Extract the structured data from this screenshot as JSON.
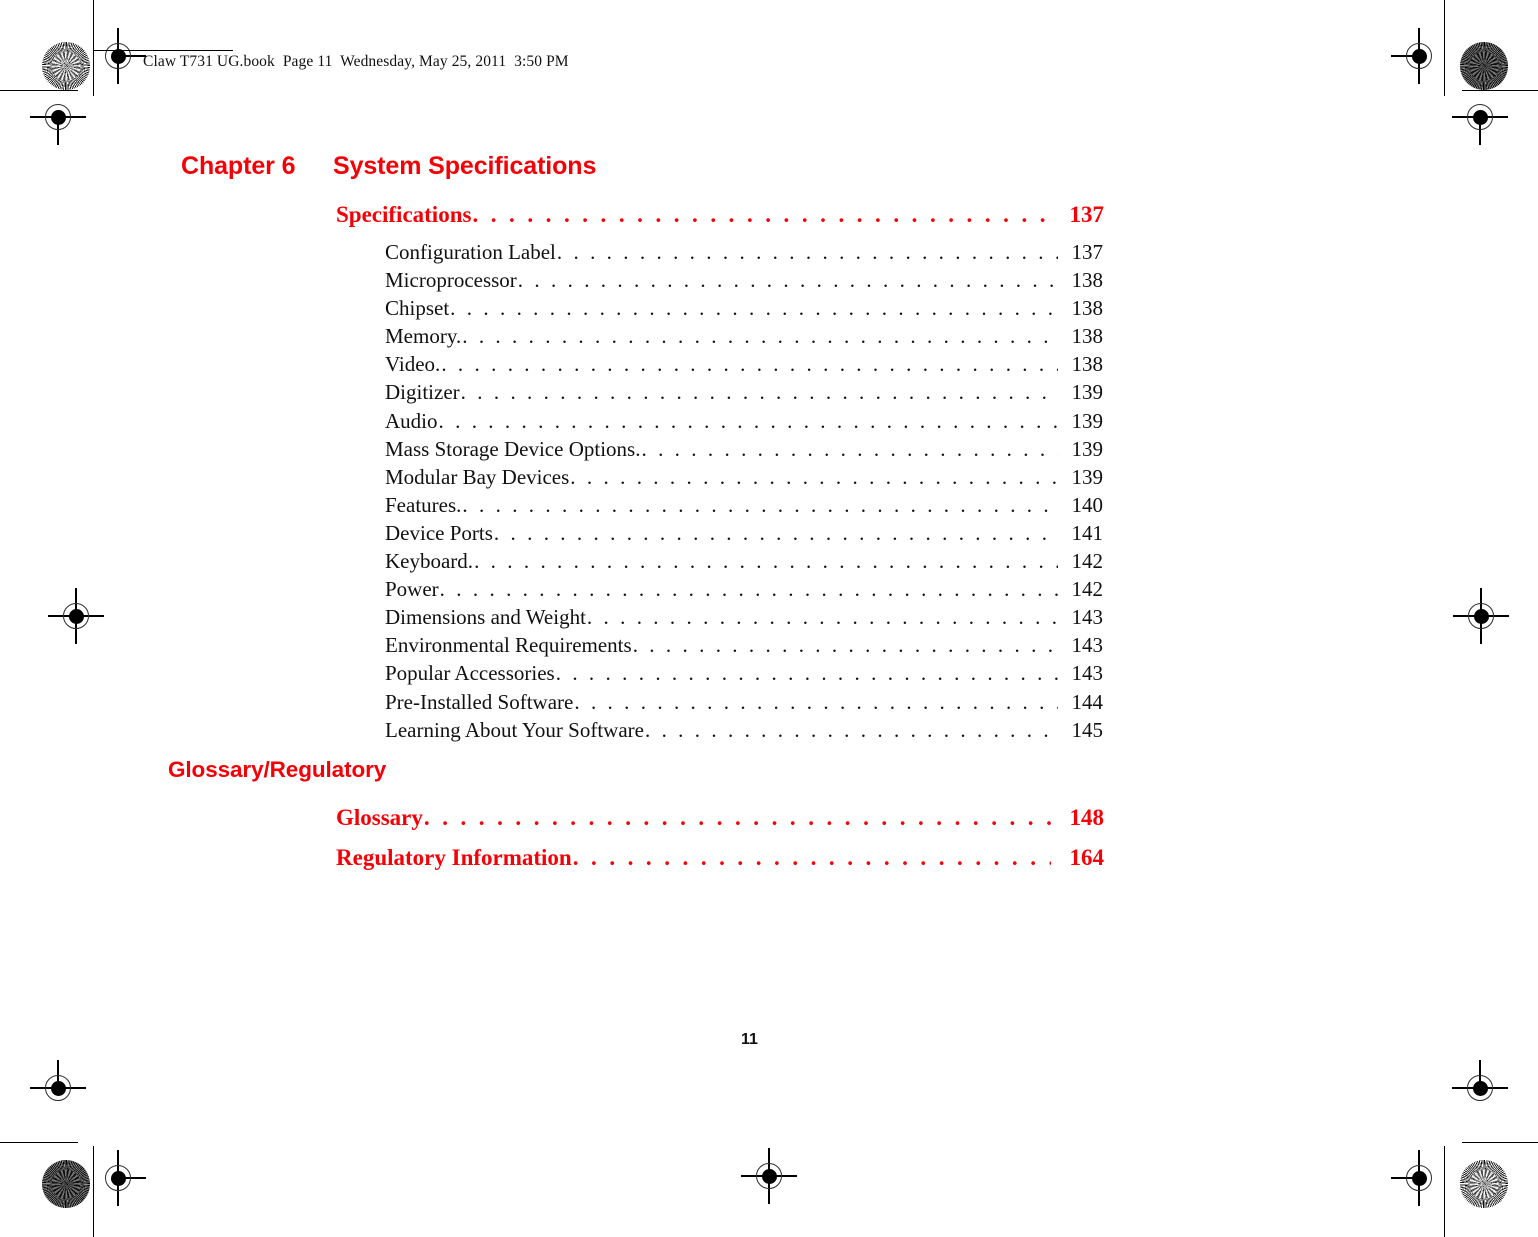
{
  "header": {
    "text": "Claw T731 UG.book  Page 11  Wednesday, May 25, 2011  3:50 PM"
  },
  "folio": {
    "page_number": "11"
  },
  "colors": {
    "accent_red": "#f60007",
    "body_black": "#111111",
    "page_background": "#ffffff"
  },
  "chapter": {
    "number_label": "Chapter 6",
    "title": "System Specifications"
  },
  "toc": {
    "sections": [
      {
        "id": "specifications",
        "heading": {
          "label": "Specifications",
          "page": "137"
        },
        "entries": [
          {
            "label": "Configuration Label",
            "page": "137"
          },
          {
            "label": "Microprocessor",
            "page": "138"
          },
          {
            "label": "Chipset",
            "page": "138"
          },
          {
            "label": "Memory.",
            "page": "138"
          },
          {
            "label": "Video.",
            "page": "138"
          },
          {
            "label": "Digitizer",
            "page": "139"
          },
          {
            "label": "Audio",
            "page": "139"
          },
          {
            "label": "Mass Storage Device Options.",
            "page": "139"
          },
          {
            "label": "Modular Bay Devices",
            "page": "139"
          },
          {
            "label": "Features.",
            "page": "140"
          },
          {
            "label": "Device Ports",
            "page": "141"
          },
          {
            "label": "Keyboard.",
            "page": "142"
          },
          {
            "label": "Power",
            "page": "142"
          },
          {
            "label": "Dimensions and Weight",
            "page": "143"
          },
          {
            "label": "Environmental Requirements",
            "page": "143"
          },
          {
            "label": "Popular Accessories",
            "page": "143"
          },
          {
            "label": "Pre-Installed Software",
            "page": "144"
          },
          {
            "label": "Learning About Your Software",
            "page": "145"
          }
        ]
      }
    ],
    "back_matter": {
      "section_title": "Glossary/Regulatory",
      "headings": [
        {
          "label": "Glossary",
          "page": "148"
        },
        {
          "label": "Regulatory Information",
          "page": "164"
        }
      ]
    },
    "leader_character": "."
  }
}
